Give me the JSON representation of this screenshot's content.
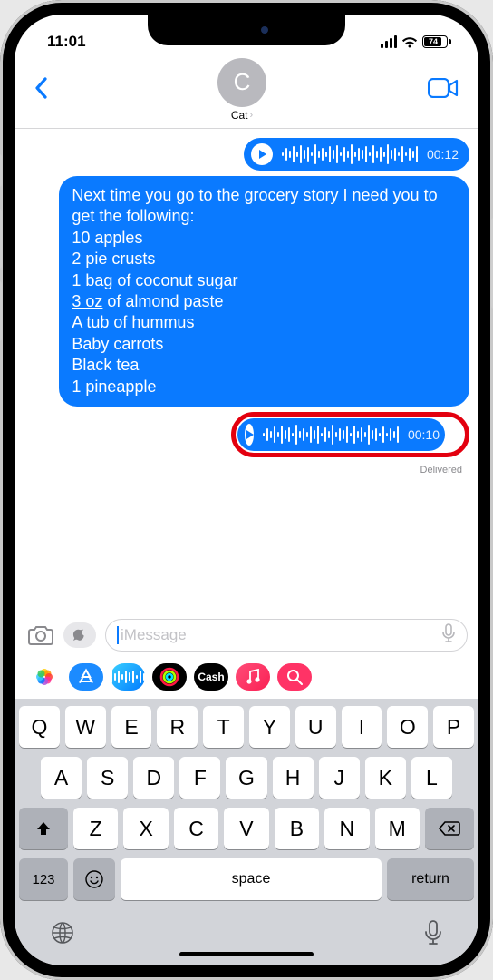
{
  "status": {
    "time": "11:01",
    "battery": "74"
  },
  "header": {
    "avatar_initial": "C",
    "contact_name": "Cat"
  },
  "messages": {
    "voice1_duration": "00:12",
    "text_body": "Next time you go to the grocery story I need you to get the following:\n10 apples\n2 pie crusts\n1 bag of coconut sugar",
    "text_underlined": "3 oz",
    "text_body2": " of almond paste\nA tub of hummus\nBaby carrots\nBlack tea\n1 pineapple",
    "voice2_duration": "00:10",
    "delivered_label": "Delivered"
  },
  "input": {
    "placeholder": "iMessage"
  },
  "appstrip": {
    "cash_label": "Cash"
  },
  "keyboard": {
    "row1": [
      "Q",
      "W",
      "E",
      "R",
      "T",
      "Y",
      "U",
      "I",
      "O",
      "P"
    ],
    "row2": [
      "A",
      "S",
      "D",
      "F",
      "G",
      "H",
      "J",
      "K",
      "L"
    ],
    "row3": [
      "Z",
      "X",
      "C",
      "V",
      "B",
      "N",
      "M"
    ],
    "num_label": "123",
    "space_label": "space",
    "return_label": "return"
  }
}
